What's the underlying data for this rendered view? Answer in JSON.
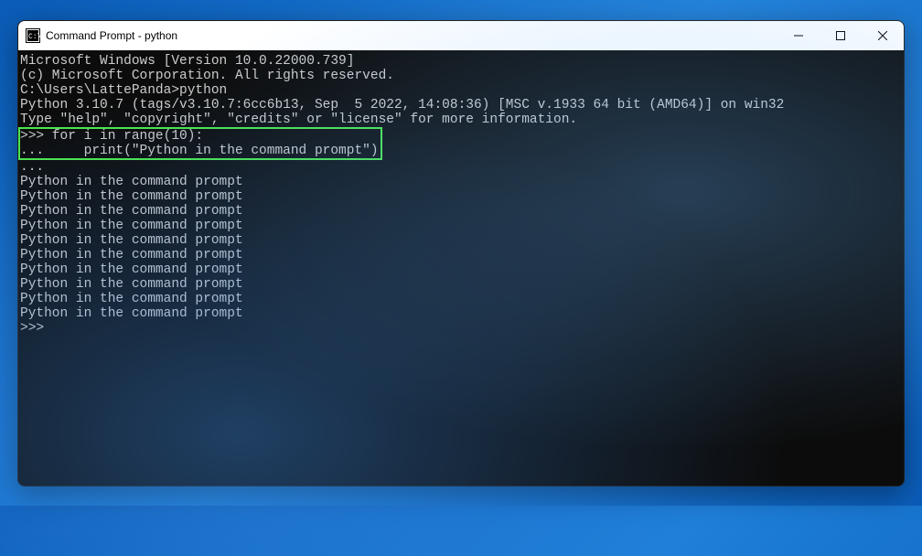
{
  "titlebar": {
    "title": "Command Prompt - python"
  },
  "terminal": {
    "header1": "Microsoft Windows [Version 10.0.22000.739]",
    "header2": "(c) Microsoft Corporation. All rights reserved.",
    "blank1": "",
    "prompt_line": "C:\\Users\\LattePanda>python",
    "python_ver": "Python 3.10.7 (tags/v3.10.7:6cc6b13, Sep  5 2022, 14:08:36) [MSC v.1933 64 bit (AMD64)] on win32",
    "python_help": "Type \"help\", \"copyright\", \"credits\" or \"license\" for more information.",
    "code_line1": ">>> for i in range(10):",
    "code_line2": "...     print(\"Python in the command prompt\")",
    "cont": "...",
    "output": [
      "Python in the command prompt",
      "Python in the command prompt",
      "Python in the command prompt",
      "Python in the command prompt",
      "Python in the command prompt",
      "Python in the command prompt",
      "Python in the command prompt",
      "Python in the command prompt",
      "Python in the command prompt",
      "Python in the command prompt"
    ],
    "final_prompt": ">>>"
  }
}
